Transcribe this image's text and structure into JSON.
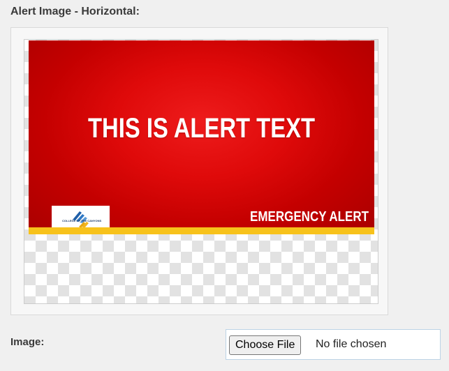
{
  "section": {
    "label": "Alert Image - Horizontal:"
  },
  "preview": {
    "alert_text": "THIS IS ALERT TEXT",
    "footer_text": "EMERGENCY ALERT",
    "logo_caption": "COLLEGE OF THE CANYONS",
    "colors": {
      "alert_red": "#df0a0a",
      "bar_yellow": "#f7c21b"
    }
  },
  "upload": {
    "label": "Image:",
    "button_label": "Choose File",
    "status": "No file chosen"
  }
}
